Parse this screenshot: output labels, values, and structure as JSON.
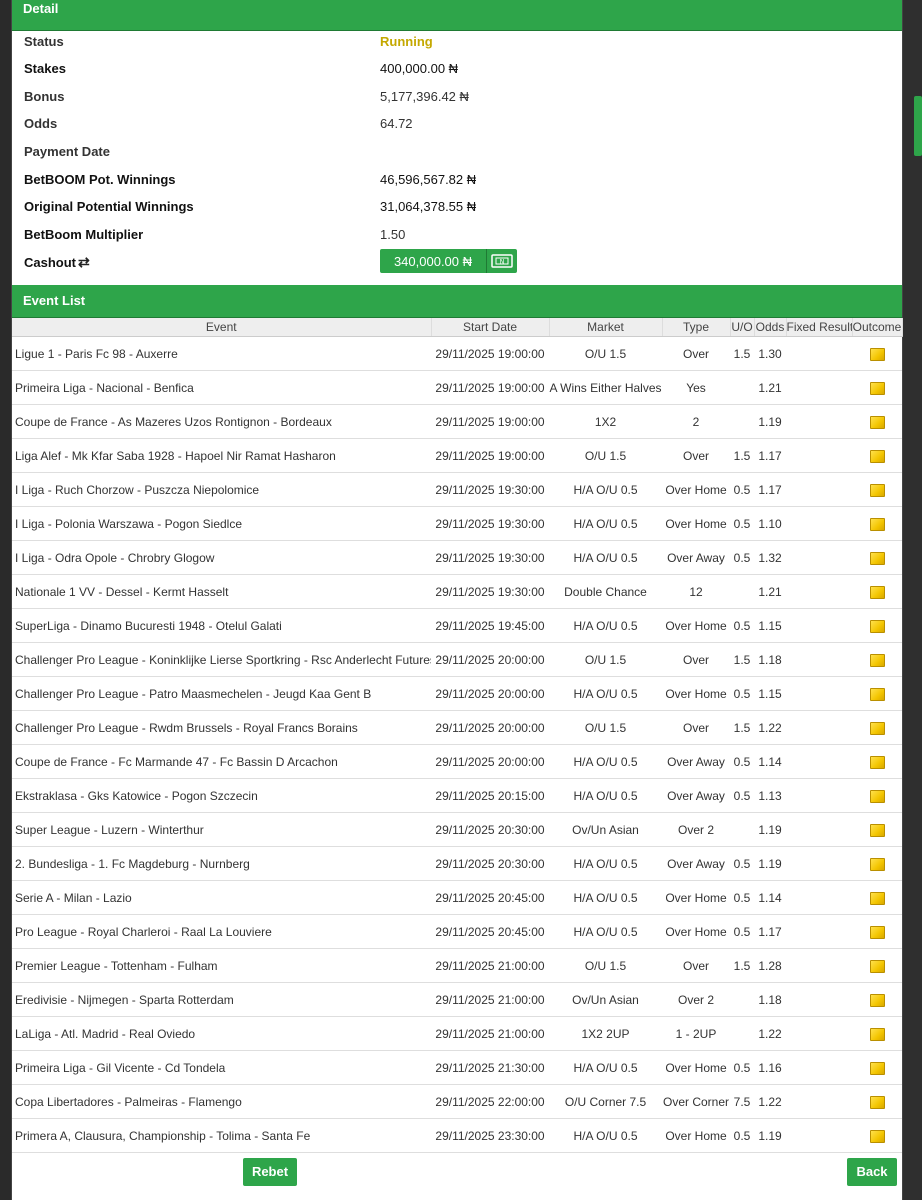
{
  "detail": {
    "header": "Detail",
    "rows": [
      {
        "label": "Status",
        "value": "Running"
      },
      {
        "label": "Stakes",
        "value": "400,000.00 ₦"
      },
      {
        "label": "Bonus",
        "value": "5,177,396.42 ₦"
      },
      {
        "label": "Odds",
        "value": "64.72"
      },
      {
        "label": "Payment Date",
        "value": ""
      },
      {
        "label": "BetBOOM Pot. Winnings",
        "value": "46,596,567.82 ₦"
      },
      {
        "label": "Original Potential Winnings",
        "value": "31,064,378.55 ₦"
      },
      {
        "label": "BetBoom Multiplier",
        "value": "1.50"
      }
    ],
    "cashout_label": "Cashout",
    "cashout_value": "340,000.00 ₦"
  },
  "events": {
    "header": "Event List",
    "columns": [
      "Event",
      "Start Date",
      "Market",
      "Type",
      "U/O",
      "Odds",
      "Fixed Result",
      "Outcome"
    ],
    "rows": [
      [
        "Ligue 1 - Paris Fc 98 - Auxerre",
        "29/11/2025 19:00:00",
        "O/U 1.5",
        "Over",
        "1.5",
        "1.30"
      ],
      [
        "Primeira Liga - Nacional - Benfica",
        "29/11/2025 19:00:00",
        "A Wins Either Halves",
        "Yes",
        "",
        "1.21"
      ],
      [
        "Coupe de France - As Mazeres Uzos Rontignon - Bordeaux",
        "29/11/2025 19:00:00",
        "1X2",
        "2",
        "",
        "1.19"
      ],
      [
        "Liga Alef - Mk Kfar Saba 1928 - Hapoel Nir Ramat Hasharon",
        "29/11/2025 19:00:00",
        "O/U 1.5",
        "Over",
        "1.5",
        "1.17"
      ],
      [
        "I Liga - Ruch Chorzow - Puszcza Niepolomice",
        "29/11/2025 19:30:00",
        "H/A O/U 0.5",
        "Over Home",
        "0.5",
        "1.17"
      ],
      [
        "I Liga - Polonia Warszawa - Pogon Siedlce",
        "29/11/2025 19:30:00",
        "H/A O/U 0.5",
        "Over Home",
        "0.5",
        "1.10"
      ],
      [
        "I Liga - Odra Opole - Chrobry Glogow",
        "29/11/2025 19:30:00",
        "H/A O/U 0.5",
        "Over Away",
        "0.5",
        "1.32"
      ],
      [
        "Nationale 1 VV - Dessel - Kermt Hasselt",
        "29/11/2025 19:30:00",
        "Double Chance",
        "12",
        "",
        "1.21"
      ],
      [
        "SuperLiga - Dinamo Bucuresti 1948 - Otelul Galati",
        "29/11/2025 19:45:00",
        "H/A O/U 0.5",
        "Over Home",
        "0.5",
        "1.15"
      ],
      [
        "Challenger Pro League - Koninklijke Lierse Sportkring - Rsc Anderlecht Futures",
        "29/11/2025 20:00:00",
        "O/U 1.5",
        "Over",
        "1.5",
        "1.18"
      ],
      [
        "Challenger Pro League - Patro Maasmechelen - Jeugd Kaa Gent B",
        "29/11/2025 20:00:00",
        "H/A O/U 0.5",
        "Over Home",
        "0.5",
        "1.15"
      ],
      [
        "Challenger Pro League - Rwdm Brussels - Royal Francs Borains",
        "29/11/2025 20:00:00",
        "O/U 1.5",
        "Over",
        "1.5",
        "1.22"
      ],
      [
        "Coupe de France - Fc Marmande 47 - Fc Bassin D Arcachon",
        "29/11/2025 20:00:00",
        "H/A O/U 0.5",
        "Over Away",
        "0.5",
        "1.14"
      ],
      [
        "Ekstraklasa - Gks Katowice - Pogon Szczecin",
        "29/11/2025 20:15:00",
        "H/A O/U 0.5",
        "Over Away",
        "0.5",
        "1.13"
      ],
      [
        "Super League - Luzern - Winterthur",
        "29/11/2025 20:30:00",
        "Ov/Un Asian",
        "Over 2",
        "",
        "1.19"
      ],
      [
        "2. Bundesliga - 1. Fc Magdeburg - Nurnberg",
        "29/11/2025 20:30:00",
        "H/A O/U 0.5",
        "Over Away",
        "0.5",
        "1.19"
      ],
      [
        "Serie A - Milan - Lazio",
        "29/11/2025 20:45:00",
        "H/A O/U 0.5",
        "Over Home",
        "0.5",
        "1.14"
      ],
      [
        "Pro League - Royal Charleroi - Raal La Louviere",
        "29/11/2025 20:45:00",
        "H/A O/U 0.5",
        "Over Home",
        "0.5",
        "1.17"
      ],
      [
        "Premier League - Tottenham - Fulham",
        "29/11/2025 21:00:00",
        "O/U 1.5",
        "Over",
        "1.5",
        "1.28"
      ],
      [
        "Eredivisie - Nijmegen - Sparta Rotterdam",
        "29/11/2025 21:00:00",
        "Ov/Un Asian",
        "Over 2",
        "",
        "1.18"
      ],
      [
        "LaLiga - Atl. Madrid - Real Oviedo",
        "29/11/2025 21:00:00",
        "1X2 2UP",
        "1 - 2UP",
        "",
        "1.22"
      ],
      [
        "Primeira Liga - Gil Vicente - Cd Tondela",
        "29/11/2025 21:30:00",
        "H/A O/U 0.5",
        "Over Home",
        "0.5",
        "1.16"
      ],
      [
        "Copa Libertadores - Palmeiras - Flamengo",
        "29/11/2025 22:00:00",
        "O/U Corner 7.5",
        "Over Corner",
        "7.5",
        "1.22"
      ],
      [
        "Primera A, Clausura, Championship - Tolima - Santa Fe",
        "29/11/2025 23:30:00",
        "H/A O/U 0.5",
        "Over Home",
        "0.5",
        "1.19"
      ]
    ]
  },
  "buttons": {
    "rebet": "Rebet",
    "back": "Back"
  },
  "colors": {
    "accent": "#2ea54a",
    "status_running": "#c4a800",
    "pending_flag": "#f3c500"
  },
  "icons": {
    "cashout": "refresh-icon",
    "cashout_button": "cash-icon",
    "outcome": "pending-flag-icon"
  }
}
